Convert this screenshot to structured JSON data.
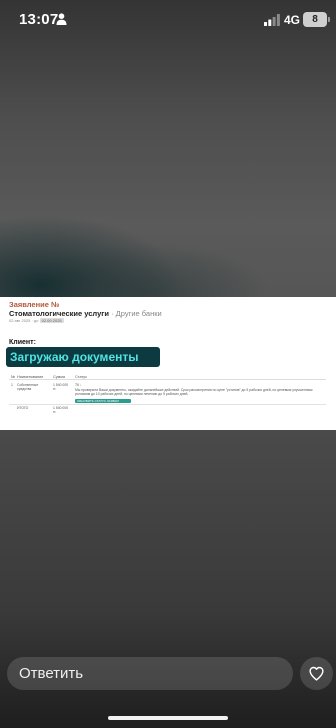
{
  "status_bar": {
    "time": "13:07",
    "network": "4G",
    "battery": "8"
  },
  "document": {
    "title": "Заявление №",
    "service": "Стоматологические услуги",
    "bank": "· Другие банки",
    "date": "02 авг 2025 · до",
    "date_chip": "02.09.2025",
    "client_label": "Клиент:",
    "overlay_caption": "Загружаю документы",
    "table": {
      "headers": [
        "№",
        "Наименование",
        "Сумма",
        "Статус"
      ],
      "rows": [
        {
          "num": "1",
          "name": "Собственные средства",
          "amount": "1 540 000 тг.",
          "status_title": "ТК ↓",
          "status_text": "Мы проверили Ваши документы, ожидайте дальнейших действий. Срок рассмотрения по цене \"устинов\" до 5 рабочих дней, по целевым улучшенным условиям до 10 рабочих дней, по целевым лечению до 5 рабочих дней.",
          "status_button": "ОБНОВИТЬ СТАТУС ЗАЯВКИ"
        },
        {
          "num": "",
          "name": "ИТОГО",
          "amount": "1 540 000 тг."
        }
      ]
    }
  },
  "reply": {
    "placeholder": "Ответить"
  },
  "icons": {
    "person": "person-icon",
    "signal": "signal-icon",
    "heart": "heart-icon"
  }
}
